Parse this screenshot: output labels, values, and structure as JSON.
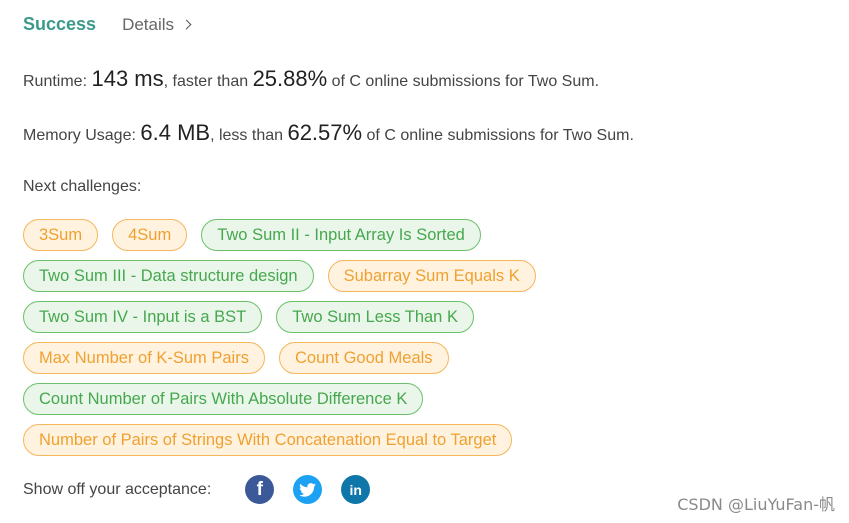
{
  "header": {
    "status": "Success",
    "details_label": "Details"
  },
  "runtime": {
    "label": "Runtime: ",
    "value": "143 ms",
    "middle": ", faster than ",
    "percent": "25.88%",
    "suffix": " of C online submissions for Two Sum."
  },
  "memory": {
    "label": "Memory Usage: ",
    "value": "6.4 MB",
    "middle": ", less than ",
    "percent": "62.57%",
    "suffix": " of C online submissions for Two Sum."
  },
  "next_challenges_label": "Next challenges:",
  "challenges": [
    {
      "label": "3Sum",
      "difficulty": "medium"
    },
    {
      "label": "4Sum",
      "difficulty": "medium"
    },
    {
      "label": "Two Sum II - Input Array Is Sorted",
      "difficulty": "easy"
    },
    {
      "label": "Two Sum III - Data structure design",
      "difficulty": "easy"
    },
    {
      "label": "Subarray Sum Equals K",
      "difficulty": "medium"
    },
    {
      "label": "Two Sum IV - Input is a BST",
      "difficulty": "easy"
    },
    {
      "label": "Two Sum Less Than K",
      "difficulty": "easy"
    },
    {
      "label": "Max Number of K-Sum Pairs",
      "difficulty": "medium"
    },
    {
      "label": "Count Good Meals",
      "difficulty": "medium"
    },
    {
      "label": "Count Number of Pairs With Absolute Difference K",
      "difficulty": "easy"
    },
    {
      "label": "Number of Pairs of Strings With Concatenation Equal to Target",
      "difficulty": "medium"
    }
  ],
  "colors": {
    "success": "#3c9a8c",
    "medium_border": "#f5b65c",
    "medium_text": "#f0a030",
    "easy_border": "#6cc06c",
    "easy_text": "#46a84e",
    "facebook": "#3b5998",
    "twitter": "#1da1f2",
    "linkedin": "#0e76a8"
  },
  "share": {
    "label": "Show off your acceptance:",
    "icons": {
      "facebook": "f",
      "linkedin": "in"
    }
  },
  "watermark": "CSDN @LiuYuFan-帆"
}
